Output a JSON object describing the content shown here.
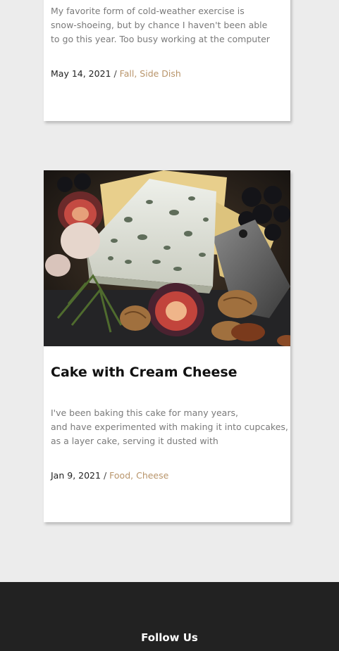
{
  "posts": [
    {
      "excerpt_lines": [
        "My favorite form of cold-weather exercise is",
        "snow-shoeing, but by chance I haven't been able",
        "to go this year. Too busy working at the computer"
      ],
      "date": "May 14, 2021",
      "separator": "/",
      "categories": [
        "Fall",
        "Side Dish"
      ]
    },
    {
      "title": "Cake with Cream Cheese",
      "excerpt_lines": [
        "I've been baking this cake for many years,",
        "and have experimented with making it into cupcakes,",
        "as a layer cake, serving it dusted with"
      ],
      "date": "Jan 9, 2021",
      "separator": "/",
      "categories": [
        "Food",
        "Cheese"
      ]
    }
  ],
  "footer": {
    "heading": "Follow Us"
  },
  "colors": {
    "background": "#ececec",
    "card": "#ffffff",
    "category_link": "#b8946a",
    "excerpt_text": "#7a7a7a",
    "footer_bg": "#222222"
  }
}
